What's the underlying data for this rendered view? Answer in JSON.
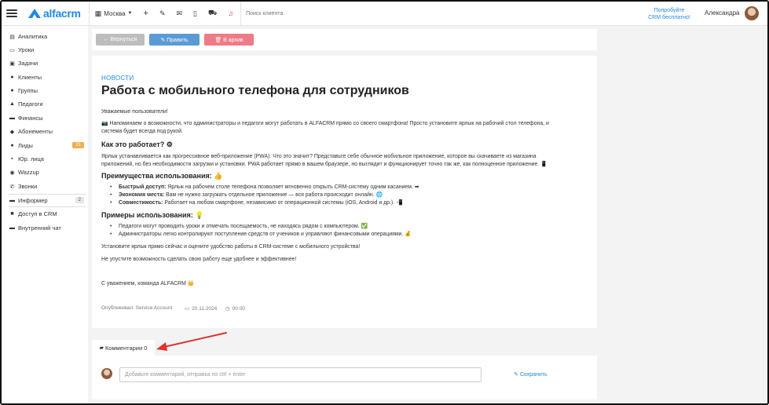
{
  "topbar": {
    "logo": "alfacrm",
    "branch": "Москва",
    "search_placeholder": "Поиск клиента",
    "promo_line1": "Попробуйте",
    "promo_line2": "CRM бесплатно!",
    "user": "Александра"
  },
  "sidebar": {
    "items": [
      {
        "label": "Аналитика",
        "icon": "chart-icon"
      },
      {
        "label": "Уроки",
        "icon": "calendar-icon"
      },
      {
        "label": "Задачи",
        "icon": "tasks-icon"
      },
      {
        "label": "Клиенты",
        "icon": "user-icon"
      },
      {
        "label": "Группы",
        "icon": "group-icon"
      },
      {
        "label": "Педагоги",
        "icon": "graduation-cap-icon"
      },
      {
        "label": "Финансы",
        "icon": "money-icon"
      },
      {
        "label": "Абонементы",
        "icon": "tag-icon"
      },
      {
        "label": "Лиды",
        "icon": "lead-icon",
        "badge": "21"
      },
      {
        "label": "Юр. лица",
        "icon": "briefcase-icon"
      },
      {
        "label": "Wazzup",
        "icon": "whatsapp-icon"
      },
      {
        "label": "Звонки",
        "icon": "phone-icon"
      },
      {
        "label": "Информер",
        "icon": "informer-icon",
        "badge": "2"
      },
      {
        "label": "Доступ в CRM",
        "icon": "lock-icon"
      },
      {
        "label": "Внутренний чат",
        "icon": "chat-icon"
      }
    ]
  },
  "actions": {
    "back": "← Вернуться",
    "edit": "✎ Править",
    "archive": "🗑 В архив"
  },
  "article": {
    "kicker": "НОВОСТИ",
    "title": "Работа с мобильного телефона для сотрудников",
    "greeting": "Уважаемые пользователи!",
    "intro_line1": "📷 Напоминаем о возможности, что администраторы и педагоги могут работать в ALFACRM прямо со своего смартфона! Просто установите ярлык на рабочий стол телефона, и",
    "intro_line2": "система будет всегда под рукой.",
    "h_how": "Как это работает? ⚙",
    "how_line1": "Ярлык устанавливается как прогрессивное веб-приложение (PWA). Что это значит? Представьте себе обычное мобильное приложение, которое вы скачиваете из магазина",
    "how_line2": "приложений, но без необходимости загрузки и установки. PWA работает прямо в вашем браузере, но выглядит и функционирует точно так же, как полноценное приложение. 📱",
    "h_adv": "Преимущества использования: 👍",
    "adv": [
      {
        "bold": "Быстрый доступ:",
        "text": " Ярлык на рабочем столе телефона позволяет мгновенно открыть CRM-систему одним касанием. ➡"
      },
      {
        "bold": "Экономия места:",
        "text": " Вам не нужно загружать отдельное приложение — вся работа происходит онлайн. 🌐"
      },
      {
        "bold": "Совместимость:",
        "text": " Работает на любом смартфоне, независимо от операционной системы (iOS, Android и др.). 📲"
      }
    ],
    "h_examples": "Примеры использования: 💡",
    "examples": [
      "Педагоги могут проводить уроки и отмечать посещаемость, не находясь рядом с компьютером. ✅",
      "Администраторы легко контролируют поступление средств от учеников и управляют финансовыми операциями. 💰"
    ],
    "cta1": "Установите ярлык прямо сейчас и оцените удобство работы в CRM-системе с мобильного устройства!",
    "cta2": "Не упустите возможность сделать свою работу еще удобнее и эффективнее!",
    "signature": "С уважением, команда ALFACRM 👑",
    "published_by": "Опубликовал: Service Account",
    "date": "20.11.2024",
    "time": "00:00"
  },
  "comments": {
    "tab_label": "Комментарии 0",
    "placeholder": "Добавьте комментарий, отправка по ctrl + enter",
    "save": "Сохранить"
  },
  "colors": {
    "accent": "#1e88e5",
    "back_button": "#bdbdbd",
    "edit_button": "#5a9bd5",
    "archive_button": "#ee7b86",
    "annotation_arrow": "#e0312f"
  }
}
